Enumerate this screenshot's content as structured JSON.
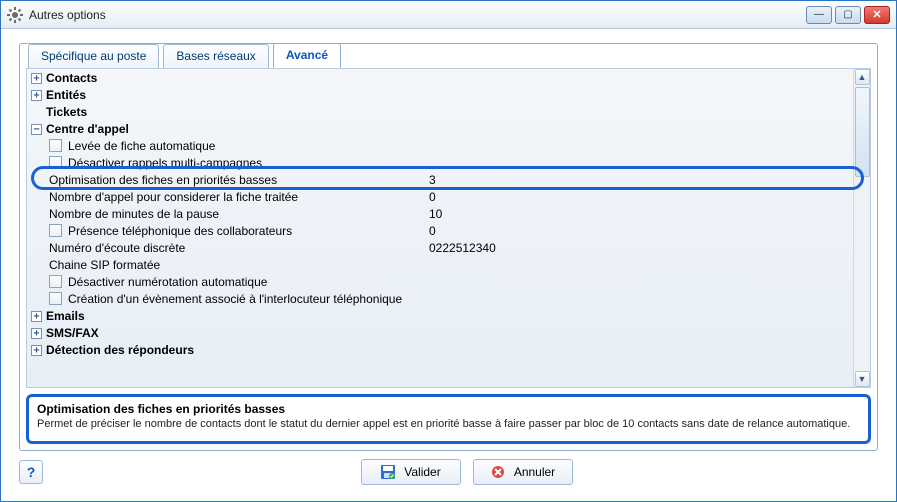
{
  "window": {
    "title": "Autres options"
  },
  "tabs": [
    {
      "label": "Spécifique au poste",
      "active": false
    },
    {
      "label": "Bases réseaux",
      "active": false
    },
    {
      "label": "Avancé",
      "active": true
    }
  ],
  "categories": {
    "contacts": {
      "label": "Contacts",
      "expanded": false
    },
    "entites": {
      "label": "Entités",
      "expanded": false
    },
    "tickets": {
      "label": "Tickets",
      "expanded": false,
      "toggleable": false
    },
    "centre_appel": {
      "label": "Centre d'appel",
      "expanded": true,
      "items": [
        {
          "type": "check",
          "label": "Levée de fiche automatique"
        },
        {
          "type": "check",
          "label": "Désactiver rappels multi-campagnes"
        },
        {
          "type": "value",
          "label": "Optimisation des fiches en priorités basses",
          "value": "3",
          "selected": true
        },
        {
          "type": "value",
          "label": "Nombre d'appel pour considerer la fiche traitée",
          "value": "0"
        },
        {
          "type": "value",
          "label": "Nombre de minutes de la pause",
          "value": "10"
        },
        {
          "type": "check_value",
          "label": "Présence téléphonique des collaborateurs",
          "value": "0"
        },
        {
          "type": "value",
          "label": "Numéro d'écoute discrète",
          "value": "0222512340"
        },
        {
          "type": "label",
          "label": "Chaine SIP formatée"
        },
        {
          "type": "check",
          "label": "Désactiver numérotation automatique"
        },
        {
          "type": "check",
          "label": "Création d'un évènement associé à l'interlocuteur téléphonique"
        }
      ]
    },
    "emails": {
      "label": "Emails",
      "expanded": false
    },
    "smsfax": {
      "label": "SMS/FAX",
      "expanded": false
    },
    "detection": {
      "label": "Détection des répondeurs",
      "expanded": false
    }
  },
  "description": {
    "title": "Optimisation des fiches en priorités basses",
    "text": "Permet de préciser le nombre de contacts dont le statut du dernier appel est en priorité basse à faire passer par bloc de 10 contacts sans date de relance automatique."
  },
  "buttons": {
    "help": "?",
    "ok": "Valider",
    "cancel": "Annuler"
  }
}
